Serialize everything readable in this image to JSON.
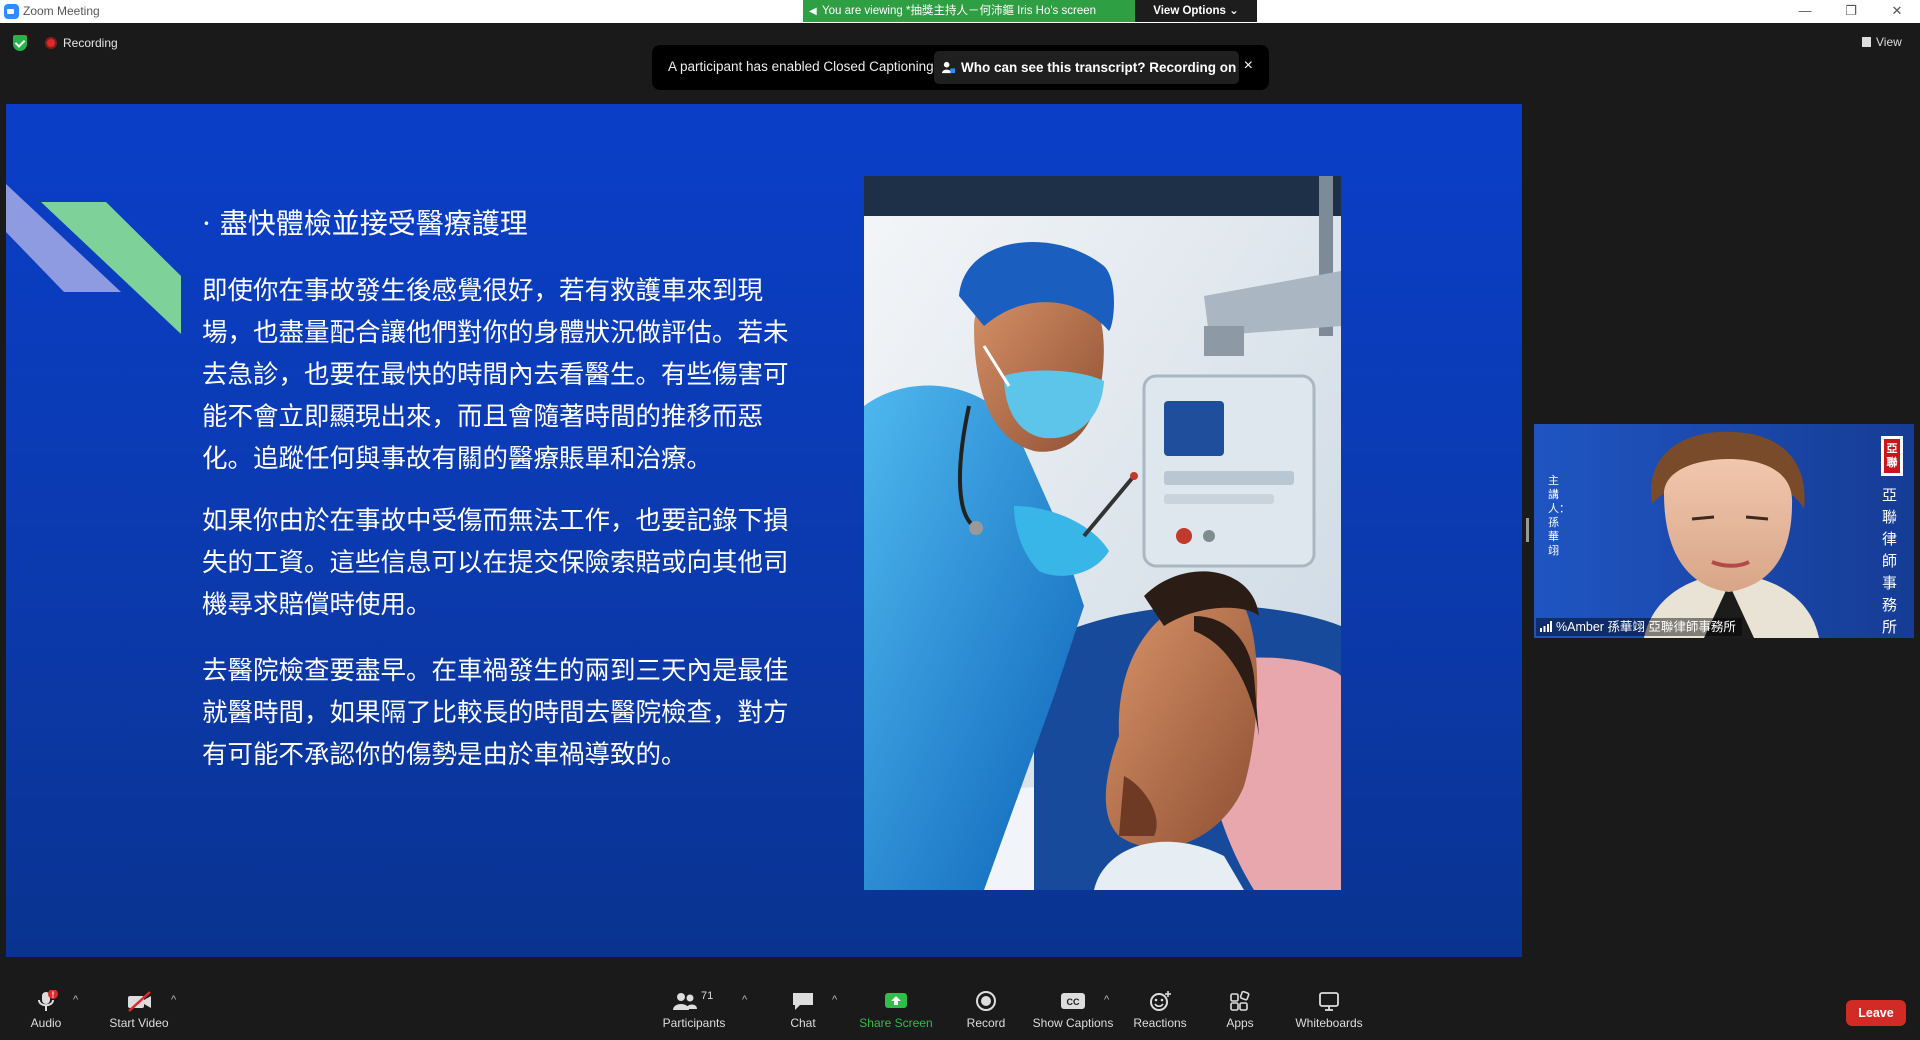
{
  "window": {
    "title": "Zoom Meeting",
    "viewing_banner": "You are viewing *抽獎主持人－何沛鏂 Iris Ho's screen",
    "view_options_label": "View Options ⌄",
    "controls": {
      "minimize": "—",
      "restore": "❐",
      "close": "✕"
    }
  },
  "meeting": {
    "recording_label": "Recording",
    "view_label": "View"
  },
  "caption_notice": {
    "message": "A participant has enabled Closed Captioning",
    "who_label": "Who can see this transcript? Recording on",
    "close_icon": "×"
  },
  "slide": {
    "bullet": "· 盡快體檢並接受醫療護理",
    "paragraph_1": "即使你在事故發生後感覺很好，若有救護車來到現場，也盡量配合讓他們對你的身體狀況做評估。若未去急診，也要在最快的時間內去看醫生。有些傷害可能不會立即顯現出來，而且會隨著時間的推移而惡化。追蹤任何與事故有關的醫療賬單和治療。",
    "paragraph_2": "如果你由於在事故中受傷而無法工作，也要記錄下損失的工資。這些信息可以在提交保險索賠或向其他司機尋求賠償時使用。",
    "paragraph_3": "去醫院檢查要盡早。在車禍發生的兩到三天內是最佳就醫時間，如果隔了比較長的時間去醫院檢查，對方有可能不承認你的傷勢是由於車禍導致的。"
  },
  "participant_tile": {
    "name": "%Amber 孫華翊 亞聯律師事務所",
    "left_overlay": "主講人：孫華翊",
    "right_overlay": "亞聯律師事務所",
    "logo_text": "亞聯"
  },
  "toolbar": {
    "audio": "Audio",
    "audio_badge": "!",
    "start_video": "Start Video",
    "participants": "Participants",
    "participants_count": "71",
    "chat": "Chat",
    "share_screen": "Share Screen",
    "record": "Record",
    "show_captions": "Show Captions",
    "reactions": "Reactions",
    "apps": "Apps",
    "whiteboards": "Whiteboards",
    "leave": "Leave",
    "caret": "^"
  },
  "colors": {
    "slide_blue": "#0a3ec8",
    "share_green": "#2fbd4c",
    "leave_red": "#d22b26",
    "banner_green": "#2ea043"
  }
}
